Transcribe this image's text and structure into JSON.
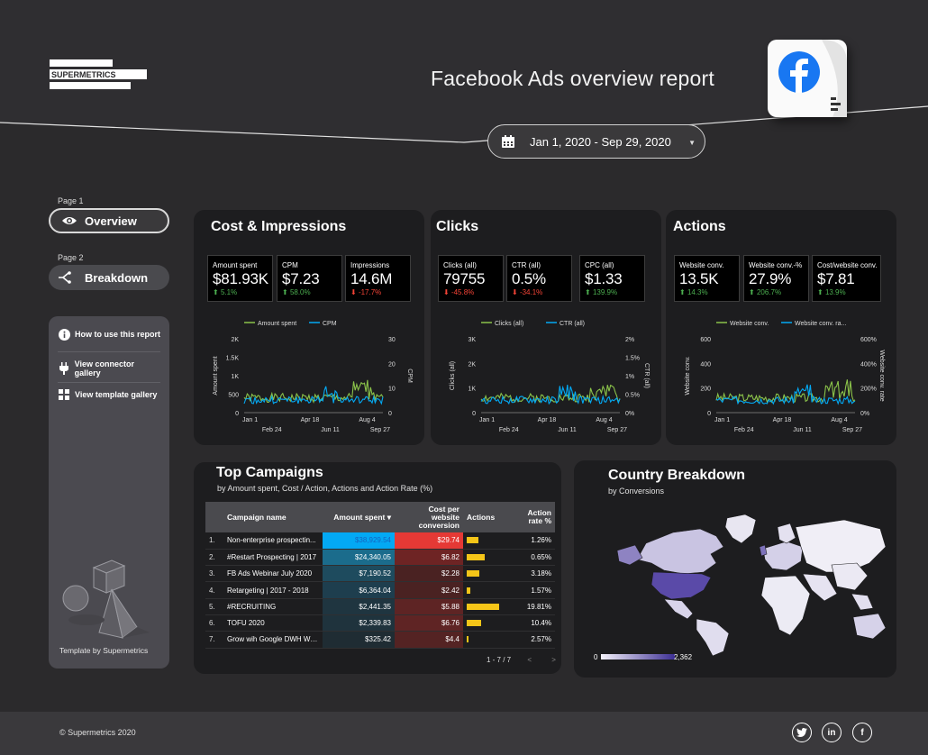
{
  "header": {
    "logo_text": "SUPERMETRICS",
    "title": "Facebook Ads overview report",
    "date_range": "Jan 1, 2020 - Sep 29, 2020"
  },
  "nav": {
    "page1_label": "Page 1",
    "overview_label": "Overview",
    "page2_label": "Page 2",
    "breakdown_label": "Breakdown"
  },
  "sidebar": {
    "links": [
      {
        "label": "How to use this report",
        "icon": "info-icon"
      },
      {
        "label": "View connector gallery",
        "icon": "plug-icon"
      },
      {
        "label": "View template gallery",
        "icon": "grid-icon"
      }
    ],
    "credit": "Template by Supermetrics"
  },
  "cost_impressions": {
    "title": "Cost & Impressions",
    "kpis": [
      {
        "label": "Amount spent",
        "value": "$81.93K",
        "delta": "5.1%",
        "dir": "up"
      },
      {
        "label": "CPM",
        "value": "$7.23",
        "delta": "58.0%",
        "dir": "up"
      },
      {
        "label": "Impressions",
        "value": "14.6M",
        "delta": "-17.7%",
        "dir": "down"
      }
    ],
    "chart": {
      "legend": [
        "Amount spent",
        "CPM"
      ],
      "ylabel_left": "Amount spent",
      "ylabel_right": "CPM",
      "left_ticks": [
        "2K",
        "1.5K",
        "1K",
        "500",
        "0"
      ],
      "right_ticks": [
        "30",
        "20",
        "10",
        "0"
      ],
      "x_ticks_top": [
        "Jan 1",
        "Apr 18",
        "Aug 4"
      ],
      "x_ticks_bottom": [
        "Feb 24",
        "Jun 11",
        "Sep 27"
      ]
    }
  },
  "clicks": {
    "title": "Clicks",
    "kpis": [
      {
        "label": "Clicks (all)",
        "value": "79755",
        "delta": "-45.8%",
        "dir": "down"
      },
      {
        "label": "CTR (all)",
        "value": "0.5%",
        "delta": "-34.1%",
        "dir": "down"
      },
      {
        "label": "CPC (all)",
        "value": "$1.33",
        "delta": "139.9%",
        "dir": "up"
      }
    ],
    "chart": {
      "legend": [
        "Clicks (all)",
        "CTR (all)"
      ],
      "ylabel_left": "Clicks (all)",
      "ylabel_right": "CTR (all)",
      "left_ticks": [
        "3K",
        "2K",
        "1K",
        "0"
      ],
      "right_ticks": [
        "2%",
        "1.5%",
        "1%",
        "0.5%",
        "0%"
      ],
      "x_ticks_top": [
        "Jan 1",
        "Apr 18",
        "Aug 4"
      ],
      "x_ticks_bottom": [
        "Feb 24",
        "Jun 11",
        "Sep 27"
      ]
    }
  },
  "actions": {
    "title": "Actions",
    "kpis": [
      {
        "label": "Website conv.",
        "value": "13.5K",
        "delta": "14.3%",
        "dir": "up"
      },
      {
        "label": "Website conv.-%",
        "value": "27.9%",
        "delta": "206.7%",
        "dir": "up"
      },
      {
        "label": "Cost/website conv.",
        "value": "$7.81",
        "delta": "13.9%",
        "dir": "up"
      }
    ],
    "chart": {
      "legend": [
        "Website conv.",
        "Website conv. ra..."
      ],
      "ylabel_left": "Website conv.",
      "ylabel_right": "Website conv. rate",
      "left_ticks": [
        "600",
        "400",
        "200",
        "0"
      ],
      "right_ticks": [
        "600%",
        "400%",
        "200%",
        "0%"
      ],
      "x_ticks_top": [
        "Jan 1",
        "Apr 18",
        "Aug 4"
      ],
      "x_ticks_bottom": [
        "Feb 24",
        "Jun 11",
        "Sep 27"
      ]
    }
  },
  "campaigns": {
    "title": "Top Campaigns",
    "subtitle": "by  Amount spent, Cost / Action, Actions and Action Rate (%)",
    "columns": [
      "Campaign name",
      "Amount spent ▾",
      "Cost per website conversion",
      "Actions",
      "Action rate %"
    ],
    "rows": [
      {
        "n": "1.",
        "name": "Non-enterprise prospectin...",
        "amount": "$38,929.54",
        "cost": "$29.74",
        "actions": 0.36,
        "rate": "1.26%"
      },
      {
        "n": "2.",
        "name": "#Restart Prospecting | 2017",
        "amount": "$24,340.05",
        "cost": "$6.82",
        "actions": 0.56,
        "rate": "0.65%"
      },
      {
        "n": "3.",
        "name": "FB Ads Webinar July 2020",
        "amount": "$7,190.52",
        "cost": "$2.28",
        "actions": 0.4,
        "rate": "3.18%"
      },
      {
        "n": "4.",
        "name": "Retargeting | 2017 - 2018",
        "amount": "$6,364.04",
        "cost": "$2.42",
        "actions": 0.12,
        "rate": "1.57%"
      },
      {
        "n": "5.",
        "name": "#RECRUITING",
        "amount": "$2,441.35",
        "cost": "$5.88",
        "actions": 1.0,
        "rate": "19.81%"
      },
      {
        "n": "6.",
        "name": "TOFU 2020",
        "amount": "$2,339.83",
        "cost": "$6.76",
        "actions": 0.44,
        "rate": "10.4%"
      },
      {
        "n": "7.",
        "name": "Grow wih Google DWH We...",
        "amount": "$325.42",
        "cost": "$4.4",
        "actions": 0.05,
        "rate": "2.57%"
      }
    ],
    "pager": "1 - 7 / 7"
  },
  "country": {
    "title": "Country Breakdown",
    "subtitle": "by Conversions",
    "scale_min": "0",
    "scale_max": "2,362"
  },
  "footer": {
    "copyright": "© Supermetrics 2020",
    "social": [
      "twitter-icon",
      "linkedin-icon",
      "facebook-icon"
    ]
  },
  "colors": {
    "green": "#8bc34a",
    "blue": "#03a9f4",
    "yellow": "#f5c518",
    "red": "#e53935",
    "cyan": "#29b6f6",
    "background": "#2b2a2c",
    "card": "#1d1d1f"
  }
}
